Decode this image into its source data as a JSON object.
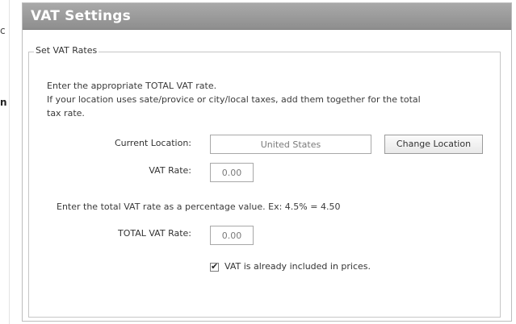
{
  "left_fragments": {
    "c": "c",
    "n": "n"
  },
  "panel": {
    "title": "VAT Settings",
    "fieldset_legend": "Set VAT Rates",
    "intro_line_1": "Enter the appropriate TOTAL VAT rate.",
    "intro_line_2": "If your location uses sate/provice or city/local taxes, add them together for the total",
    "intro_line_3": "tax rate.",
    "current_location_label": "Current Location:",
    "current_location_value": "United States",
    "change_location_button": "Change Location",
    "vat_rate_label": "VAT Rate:",
    "vat_rate_value": "0.00",
    "instruction": "Enter the total VAT rate as a percentage value.  Ex: 4.5% = 4.50",
    "total_vat_rate_label": "TOTAL VAT Rate:",
    "total_vat_rate_value": "0.00",
    "included_checkbox_label": "VAT is already included in prices.",
    "included_checked": true
  },
  "colors": {
    "header_bg": "#9b9b9b",
    "header_text": "#ffffff",
    "border": "#bdbdbd"
  }
}
